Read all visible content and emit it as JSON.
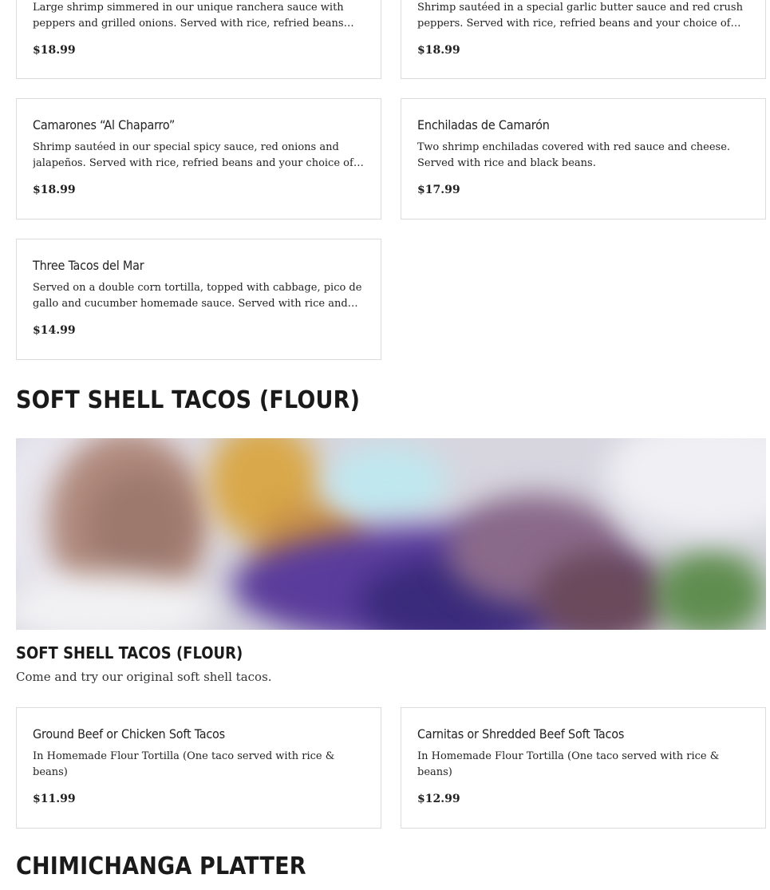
{
  "top_items": [
    {
      "name": "",
      "description": "Large shrimp simmered in our unique ranchera sauce with peppers and grilled onions. Served with rice, refried beans and your choice of tortillas.",
      "price": "$18.99"
    },
    {
      "name": "",
      "description": "Shrimp sautéed in a special garlic butter sauce and red crush peppers. Served with rice, refried beans and your choice of tortillas.",
      "price": "$18.99"
    }
  ],
  "seafood_items": [
    {
      "name": "Camarones “Al Chaparro”",
      "description": "Shrimp sautéed in our special spicy sauce, red onions and jalapeños. Served with rice, refried beans and your choice of tortillas.",
      "price": "$18.99"
    },
    {
      "name": "Enchiladas de Camarón",
      "description": "Two shrimp enchiladas covered with red sauce and cheese. Served with rice and black beans.",
      "price": "$17.99"
    },
    {
      "name": "Three Tacos del Mar",
      "description": "Served on a double corn tortilla, topped with cabbage, pico de gallo and cucumber homemade sauce. Served with rice and beans.",
      "price": "$14.99"
    }
  ],
  "soft_shell_section": {
    "title": "SOFT SHELL TACOS (FLOUR)",
    "subheading": "SOFT SHELL TACOS (FLOUR)",
    "description": "Come and try our original soft shell tacos.",
    "items": [
      {
        "name": "Ground Beef or Chicken Soft Tacos",
        "description": "In Homemade Flour Tortilla (One taco served with rice & beans)",
        "price": "$11.99"
      },
      {
        "name": "Carnitas or Shredded Beef Soft Tacos",
        "description": "In Homemade Flour Tortilla (One taco served with rice & beans)",
        "price": "$12.99"
      }
    ]
  },
  "next_section": {
    "title": "CHIMICHANGA PLATTER"
  }
}
